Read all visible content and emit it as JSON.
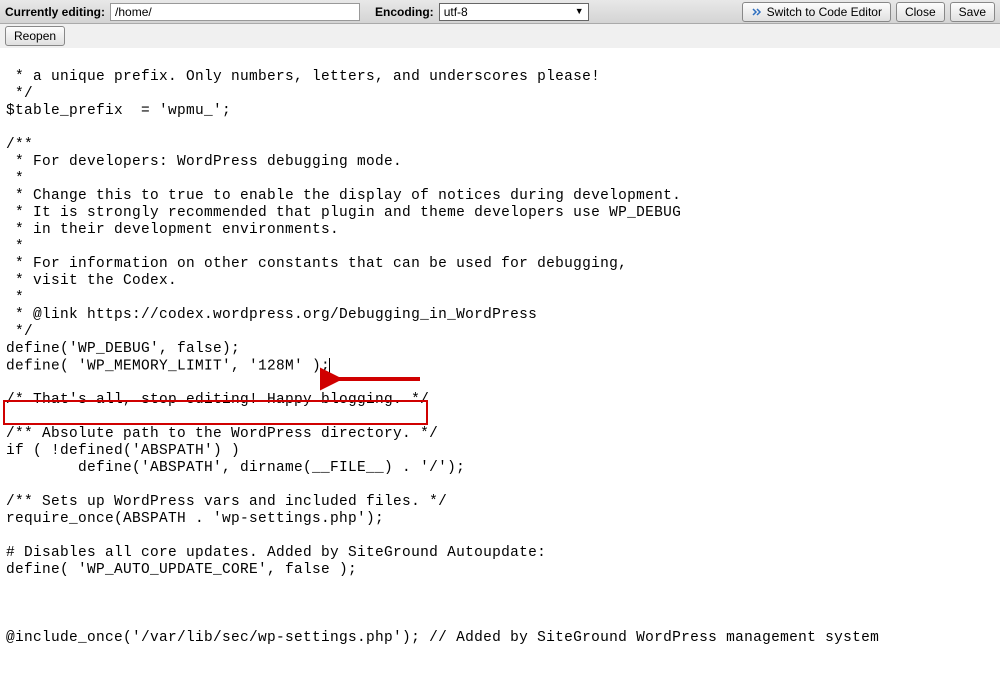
{
  "toolbar": {
    "editing_label": "Currently editing:",
    "path_value": "/home/",
    "encoding_label": "Encoding:",
    "encoding_value": "utf-8",
    "switch_label": "Switch to Code Editor",
    "close_label": "Close",
    "save_label": "Save"
  },
  "secondary": {
    "reopen_label": "Reopen"
  },
  "code": {
    "line1": " * a unique prefix. Only numbers, letters, and underscores please!",
    "line2": " */",
    "line3": "$table_prefix  = 'wpmu_';",
    "line4": "",
    "line5": "/**",
    "line6": " * For developers: WordPress debugging mode.",
    "line7": " *",
    "line8": " * Change this to true to enable the display of notices during development.",
    "line9": " * It is strongly recommended that plugin and theme developers use WP_DEBUG",
    "line10": " * in their development environments.",
    "line11": " *",
    "line12": " * For information on other constants that can be used for debugging,",
    "line13": " * visit the Codex.",
    "line14": " *",
    "line15": " * @link https://codex.wordpress.org/Debugging_in_WordPress",
    "line16": " */",
    "line17": "define('WP_DEBUG', false);",
    "line18": "define( 'WP_MEMORY_LIMIT', '128M' );",
    "line19": "",
    "line20": "/* That's all, stop editing! Happy blogging. */",
    "line21": "",
    "line22": "/** Absolute path to the WordPress directory. */",
    "line23": "if ( !defined('ABSPATH') )",
    "line24": "        define('ABSPATH', dirname(__FILE__) . '/');",
    "line25": "",
    "line26": "/** Sets up WordPress vars and included files. */",
    "line27": "require_once(ABSPATH . 'wp-settings.php');",
    "line28": "",
    "line29": "# Disables all core updates. Added by SiteGround Autoupdate:",
    "line30": "define( 'WP_AUTO_UPDATE_CORE', false );",
    "line31": "",
    "line32": "",
    "line33": "",
    "line34": "@include_once('/var/lib/sec/wp-settings.php'); // Added by SiteGround WordPress management system"
  }
}
